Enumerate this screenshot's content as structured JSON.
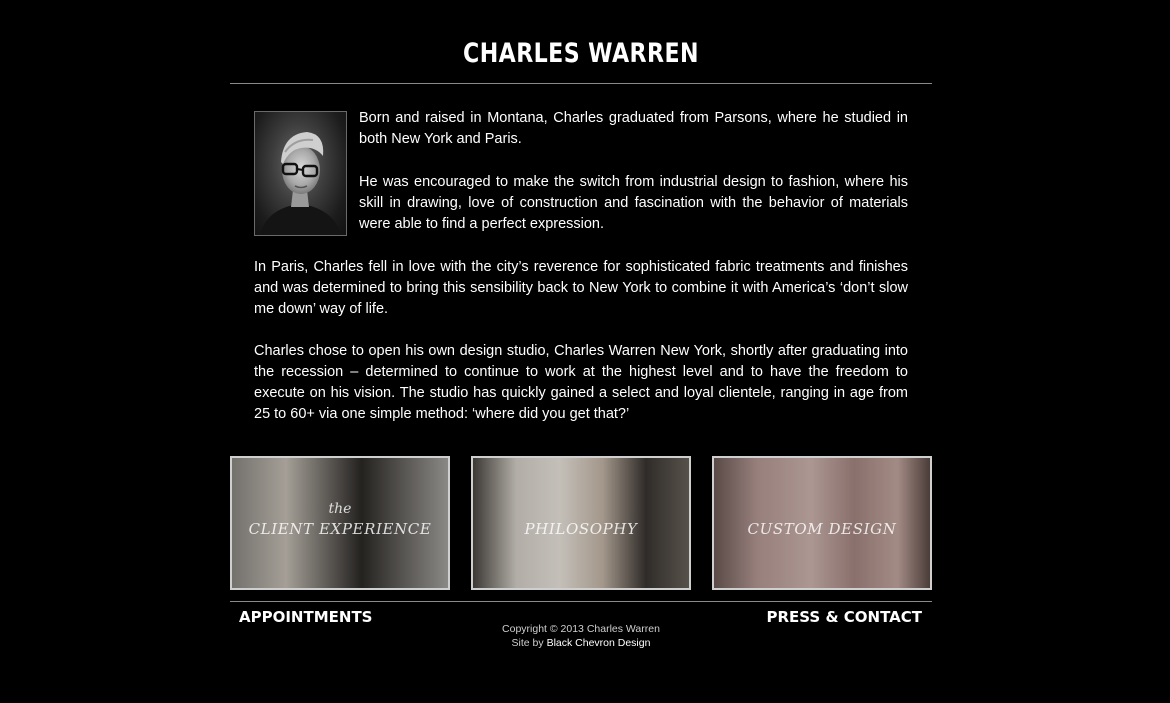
{
  "header": {
    "title": "CHARLES WARREN"
  },
  "bio": {
    "paragraphs": [
      "Born and raised in Montana, Charles graduated from Parsons, where he studied in both New York and Paris.",
      "He was encouraged to make the switch from industrial design to fashion, where his skill in drawing, love of construction and fascination with the behavior of materials were able to find a perfect expression.",
      "In Paris, Charles fell in love with the city’s reverence for sophisticated fabric treatments and finishes and was determined to bring this sensibility back to New York to combine it with America’s ‘don’t slow me down’ way of life.",
      "Charles chose to open his own design studio, Charles Warren New York, shortly after graduating into the recession – determined to continue to work at the highest level and to have the freedom to execute on his vision. The studio has quickly gained a select and loyal clientele, ranging in age from 25 to 60+ via one simple method: ‘where did you get that?’"
    ]
  },
  "tiles": [
    {
      "pre": "the",
      "label": "CLIENT EXPERIENCE"
    },
    {
      "pre": "",
      "label": "PHILOSOPHY"
    },
    {
      "pre": "",
      "label": "CUSTOM DESIGN"
    }
  ],
  "footer": {
    "left_link": "APPOINTMENTS",
    "right_link": "PRESS & CONTACT",
    "copyright": "Copyright © 2013 Charles Warren",
    "site_by_prefix": "Site by",
    "site_by_link": "Black Chevron Design"
  },
  "colors": {
    "background": "#000000",
    "text": "#ffffff",
    "rule": "#8a8a8a",
    "tile_border": "#cfcfcf"
  }
}
